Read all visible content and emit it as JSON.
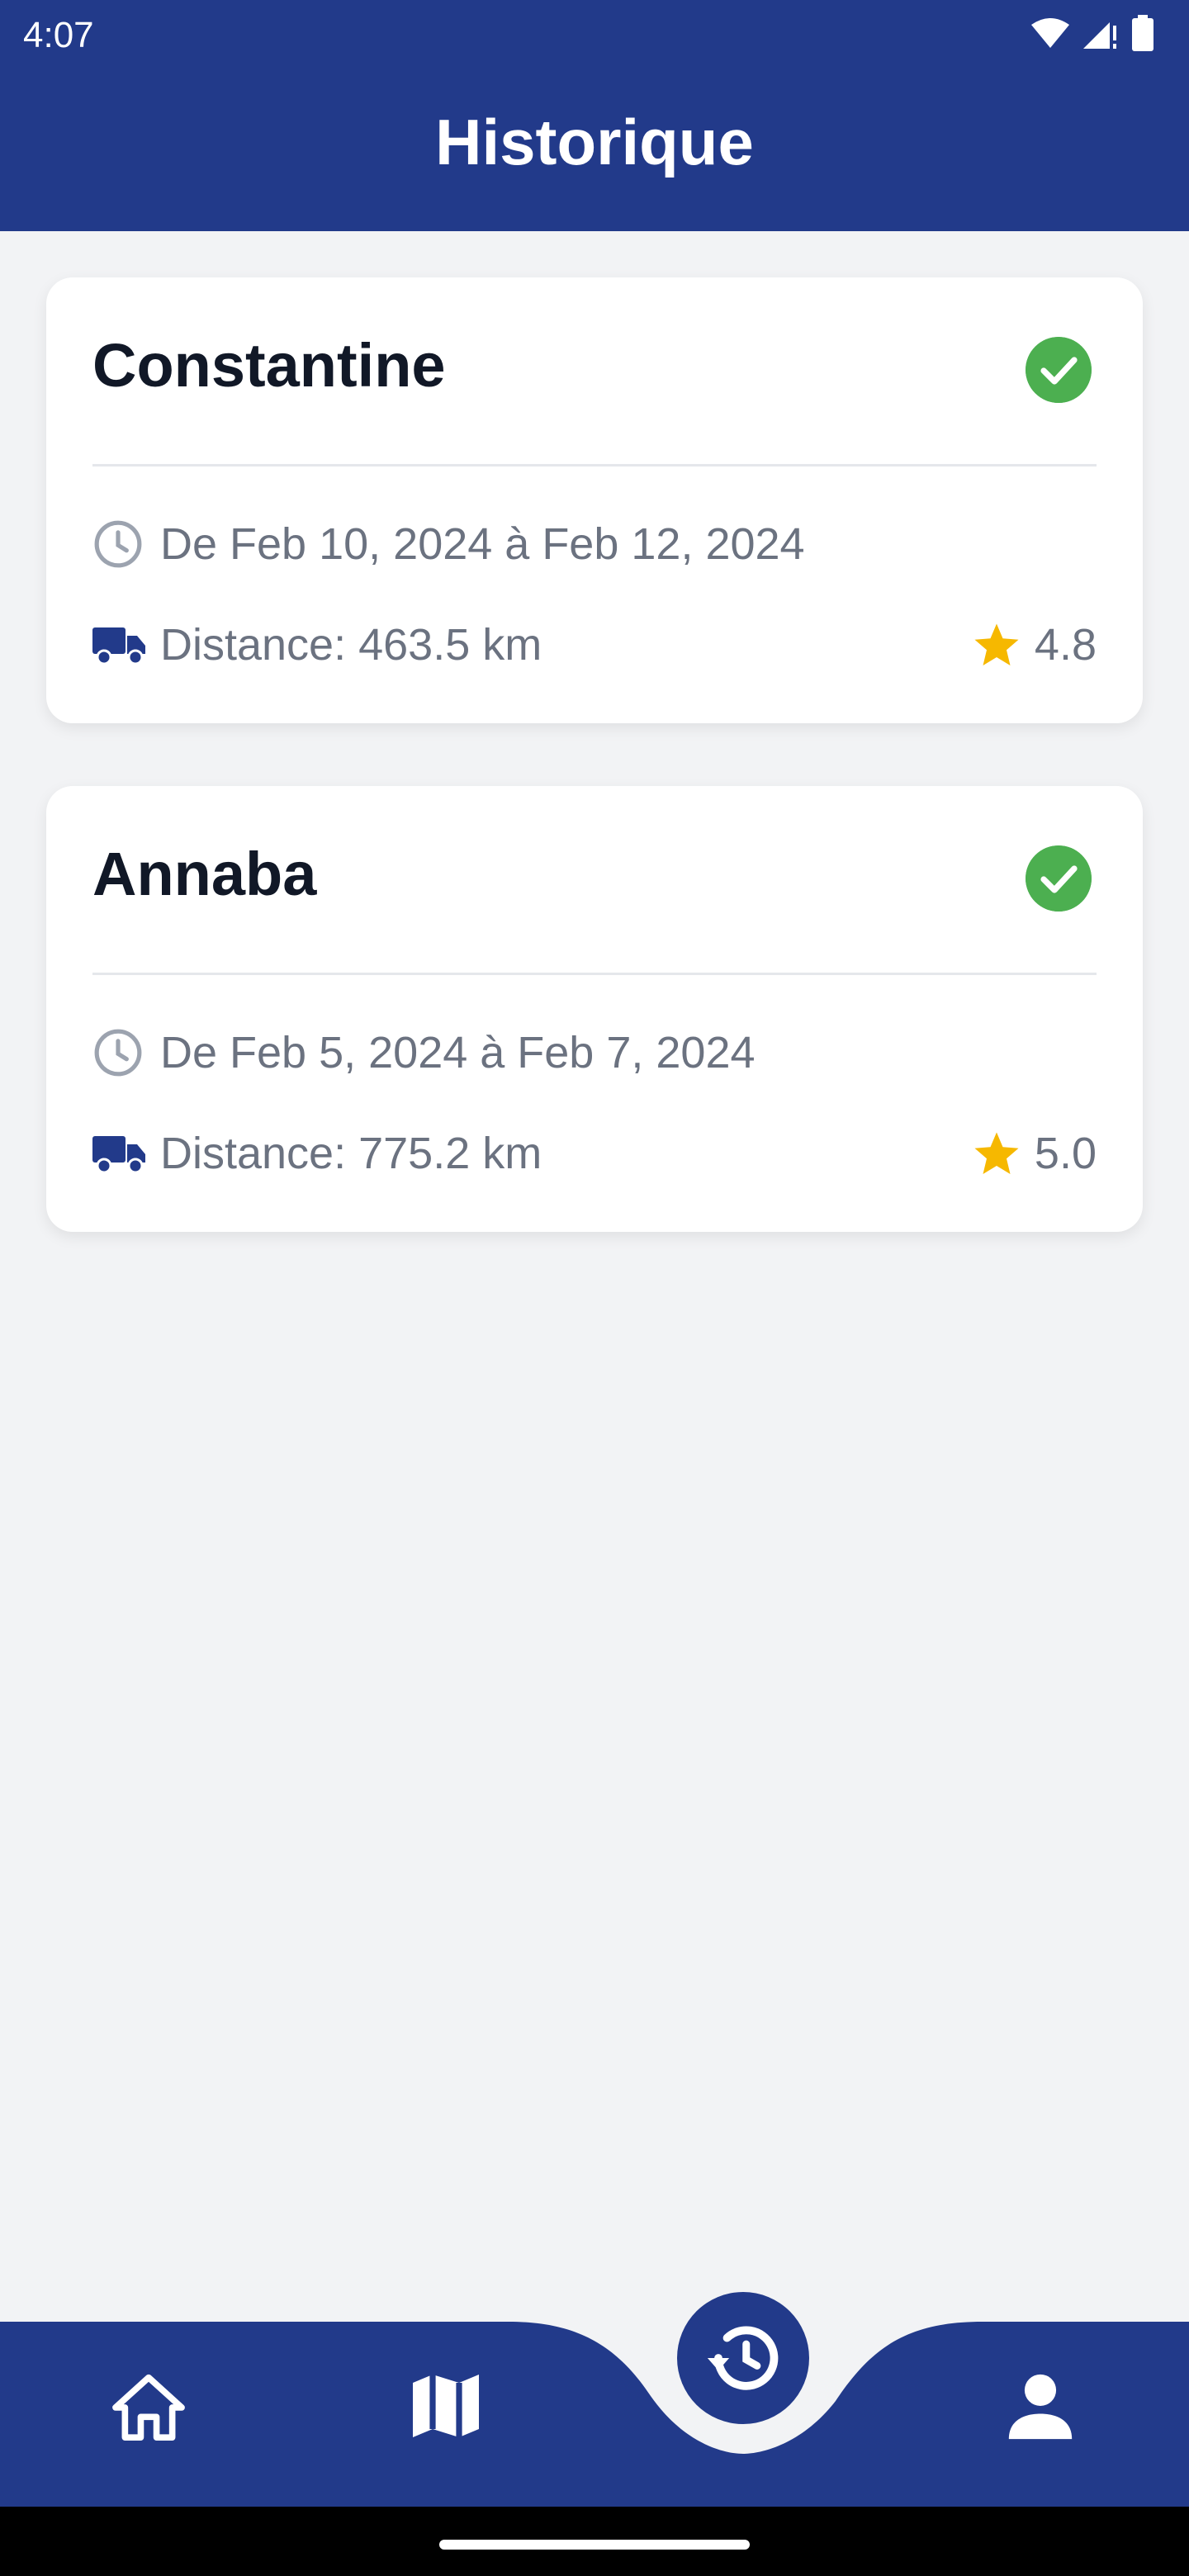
{
  "status_bar": {
    "time": "4:07"
  },
  "header": {
    "title": "Historique"
  },
  "trips": [
    {
      "city": "Constantine",
      "dates": "De Feb 10, 2024 à Feb 12, 2024",
      "distance": "Distance: 463.5 km",
      "rating": "4.8",
      "status_icon": "check-circle-icon"
    },
    {
      "city": "Annaba",
      "dates": "De Feb 5, 2024 à Feb 7, 2024",
      "distance": "Distance: 775.2 km",
      "rating": "5.0",
      "status_icon": "check-circle-icon"
    }
  ],
  "nav": {
    "items": [
      {
        "icon": "home-icon"
      },
      {
        "icon": "map-icon"
      },
      {
        "icon": "history-icon",
        "active": true
      },
      {
        "icon": "person-icon"
      }
    ]
  },
  "colors": {
    "primary": "#223a8a",
    "success": "#4caf50",
    "star": "#f6b800",
    "background": "#f2f3f5",
    "text_dark": "#111827",
    "text_muted": "#6b7280"
  }
}
